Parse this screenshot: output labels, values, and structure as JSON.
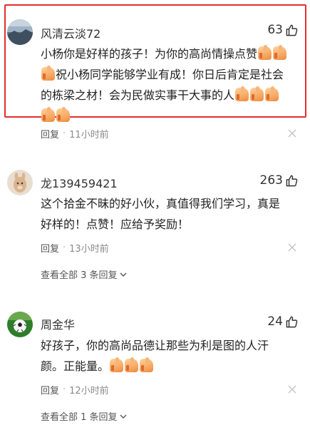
{
  "comments": [
    {
      "username": "风清云淡72",
      "likes": "63",
      "text_lines": [
        "小杨你是好样的孩子！为你的高尚情操点赞",
        "祝小杨同学能够学业有成！你日后肯定是社会",
        "的栋梁之材！会为民做实事干大事的人",
        ""
      ],
      "reply_label": "回复",
      "separator": "·",
      "time": "11小时前",
      "avatar": "landscape-avatar",
      "highlighted": true
    },
    {
      "username": "龙139459421",
      "likes": "263",
      "text_lines": [
        "这个拾金不昧的好小伙，真值得我们学习，真是",
        "好样的！点赞！应给予奖励！"
      ],
      "reply_label": "回复",
      "separator": "·",
      "time": "13小时前",
      "avatar": "alpaca-avatar",
      "view_all": "查看全部 3 条回复"
    },
    {
      "username": "周金华",
      "likes": "24",
      "text_lines": [
        "好孩子，你的高尚品德让那些为利是图的人汗",
        "颜。正能量。"
      ],
      "reply_label": "回复",
      "separator": "·",
      "time": "12小时前",
      "avatar": "soccer-avatar",
      "view_all": "查看全部 1 条回复"
    }
  ],
  "colors": {
    "highlight_border": "#e0302e",
    "meta_text": "#8a8a8a"
  }
}
